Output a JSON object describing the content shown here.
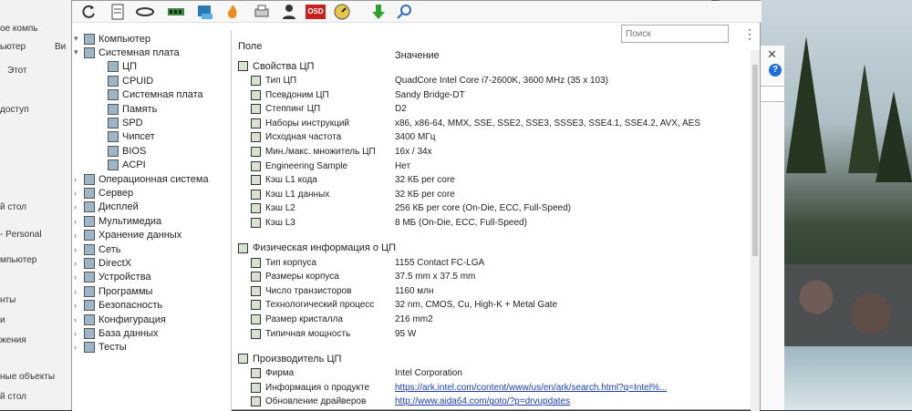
{
  "background_window": {
    "items": [
      "ое компь",
      "ьютер",
      "Этот",
      "доступ",
      "й стол",
      "- Personal",
      "мпьютер",
      "нты",
      "и",
      "жения",
      "ные объекты",
      "й стол"
    ],
    "vi_label": "Ви"
  },
  "search": {
    "placeholder": "Поиск"
  },
  "tree": [
    {
      "label": "Компьютер",
      "level": 0
    },
    {
      "label": "Системная плата",
      "level": 0
    },
    {
      "label": "ЦП",
      "level": 1
    },
    {
      "label": "CPUID",
      "level": 1
    },
    {
      "label": "Системная плата",
      "level": 1
    },
    {
      "label": "Память",
      "level": 1
    },
    {
      "label": "SPD",
      "level": 1
    },
    {
      "label": "Чипсет",
      "level": 1
    },
    {
      "label": "BIOS",
      "level": 1
    },
    {
      "label": "ACPI",
      "level": 1
    },
    {
      "label": "Операционная система",
      "level": 0
    },
    {
      "label": "Сервер",
      "level": 0
    },
    {
      "label": "Дисплей",
      "level": 0
    },
    {
      "label": "Мультимедиа",
      "level": 0
    },
    {
      "label": "Хранение данных",
      "level": 0
    },
    {
      "label": "Сеть",
      "level": 0
    },
    {
      "label": "DirectX",
      "level": 0
    },
    {
      "label": "Устройства",
      "level": 0
    },
    {
      "label": "Программы",
      "level": 0
    },
    {
      "label": "Безопасность",
      "level": 0
    },
    {
      "label": "Конфигурация",
      "level": 0
    },
    {
      "label": "База данных",
      "level": 0
    },
    {
      "label": "Тесты",
      "level": 0
    }
  ],
  "columns": {
    "field": "Поле",
    "value": "Значение"
  },
  "sections": [
    {
      "title": "Свойства ЦП",
      "rows": [
        {
          "field": "Тип ЦП",
          "value": "QuadCore Intel Core i7-2600K, 3600 MHz (35 x 103)"
        },
        {
          "field": "Псевдоним ЦП",
          "value": "Sandy Bridge-DT"
        },
        {
          "field": "Степпинг ЦП",
          "value": "D2"
        },
        {
          "field": "Наборы инструкций",
          "value": "x86, x86-64, MMX, SSE, SSE2, SSE3, SSSE3, SSE4.1, SSE4.2, AVX, AES"
        },
        {
          "field": "Исходная частота",
          "value": "3400 МГц"
        },
        {
          "field": "Мин./макс. множитель ЦП",
          "value": "16x / 34x"
        },
        {
          "field": "Engineering Sample",
          "value": "Нет"
        },
        {
          "field": "Кэш L1 кода",
          "value": "32 КБ per core"
        },
        {
          "field": "Кэш L1 данных",
          "value": "32 КБ per core"
        },
        {
          "field": "Кэш L2",
          "value": "256 КБ per core  (On-Die, ECC, Full-Speed)"
        },
        {
          "field": "Кэш L3",
          "value": "8 МБ  (On-Die, ECC, Full-Speed)"
        }
      ]
    },
    {
      "title": "Физическая информация о ЦП",
      "rows": [
        {
          "field": "Тип корпуса",
          "value": "1155 Contact FC-LGA"
        },
        {
          "field": "Размеры корпуса",
          "value": "37.5 mm x 37.5 mm"
        },
        {
          "field": "Число транзисторов",
          "value": "1160 млн"
        },
        {
          "field": "Технологический процесс",
          "value": "32 nm, CMOS, Cu, High-K + Metal Gate"
        },
        {
          "field": "Размер кристалла",
          "value": "216 mm2"
        },
        {
          "field": "Типичная мощность",
          "value": "95 W"
        }
      ]
    },
    {
      "title": "Производитель ЦП",
      "rows": [
        {
          "field": "Фирма",
          "value": "Intel Corporation"
        },
        {
          "field": "Информация о продукте",
          "value": "https://ark.intel.com/content/www/us/en/ark/search.html?q=Intel%..."
        },
        {
          "field": "Обновление драйверов",
          "value": "http://www.aida64.com/goto/?p=drvupdates"
        }
      ]
    }
  ],
  "toolbar_icons": [
    "refresh-icon",
    "report-icon",
    "network-icon",
    "memory-icon",
    "motherboard-icon",
    "flame-icon",
    "printer-icon",
    "user-icon",
    "osd-icon",
    "gauge-icon",
    "download-icon",
    "search-icon"
  ],
  "osd_label": "OSD"
}
